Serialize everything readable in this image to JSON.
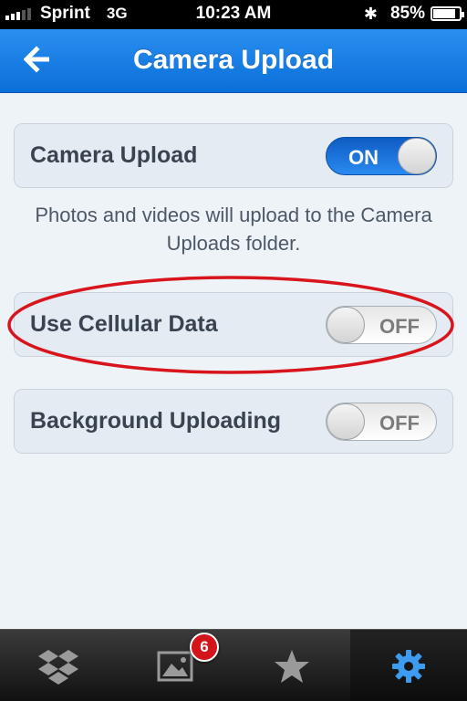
{
  "status_bar": {
    "carrier": "Sprint",
    "network": "3G",
    "time": "10:23 AM",
    "battery": "85%"
  },
  "nav": {
    "title": "Camera Upload",
    "back_icon": "back-arrow-icon"
  },
  "settings": [
    {
      "label": "Camera Upload",
      "state": "ON"
    },
    {
      "label": "Use Cellular Data",
      "state": "OFF"
    },
    {
      "label": "Background Uploading",
      "state": "OFF"
    }
  ],
  "footnote": "Photos and videos will upload to the Camera Uploads folder.",
  "tabs": [
    {
      "icon": "dropbox-icon"
    },
    {
      "icon": "photos-icon",
      "badge": "6"
    },
    {
      "icon": "star-icon"
    },
    {
      "icon": "gear-icon",
      "active": true
    }
  ],
  "colors": {
    "nav_blue": "#1a7fe6",
    "toggle_on": "#1f7ae6",
    "highlight_ellipse": "#d8141c",
    "active_tab_icon": "#3d9cf0"
  }
}
